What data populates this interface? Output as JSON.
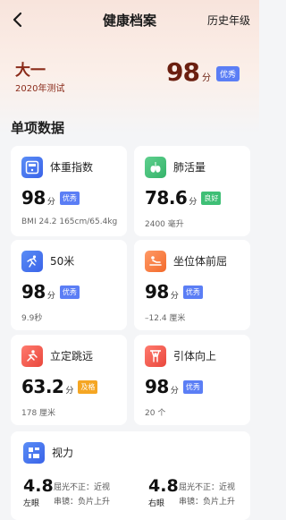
{
  "nav": {
    "title": "健康档案",
    "history": "历史年级"
  },
  "profile": {
    "name": "大一",
    "test_year": "2020年测试",
    "score": "98",
    "unit": "分",
    "badge": "优秀",
    "badge_color": "#5b7ef5"
  },
  "section_title": "单项数据",
  "cards": [
    {
      "name": "体重指数",
      "icon": "bmi-scale-icon",
      "value": "98",
      "unit": "分",
      "badge": "优秀",
      "badge_color": "#5b7ef5",
      "detail": "BMI 24.2  165cm/65.4kg"
    },
    {
      "name": "肺活量",
      "icon": "lungs-icon",
      "value": "78.6",
      "unit": "分",
      "badge": "良好",
      "badge_color": "#3fbf76",
      "detail": "2400 毫升"
    },
    {
      "name": "50米",
      "icon": "sprint-icon",
      "value": "98",
      "unit": "分",
      "badge": "优秀",
      "badge_color": "#5b7ef5",
      "detail": "9.9秒"
    },
    {
      "name": "坐位体前屈",
      "icon": "sit-reach-icon",
      "value": "98",
      "unit": "分",
      "badge": "优秀",
      "badge_color": "#5b7ef5",
      "detail": "–12.4 厘米"
    },
    {
      "name": "立定跳远",
      "icon": "long-jump-icon",
      "value": "63.2",
      "unit": "分",
      "badge": "及格",
      "badge_color": "#f5a623",
      "detail": "178 厘米"
    },
    {
      "name": "引体向上",
      "icon": "pull-up-icon",
      "value": "98",
      "unit": "分",
      "badge": "优秀",
      "badge_color": "#5b7ef5",
      "detail": "20 个"
    }
  ],
  "vision": {
    "name": "视力",
    "icon": "vision-icon",
    "left": {
      "value": "4.8",
      "label": "左眼",
      "refraction": "屈光不正：近视",
      "lens": "串镜：负片上升"
    },
    "right": {
      "value": "4.8",
      "label": "右眼",
      "refraction": "屈光不正：近视",
      "lens": "串镜：负片上升"
    }
  }
}
